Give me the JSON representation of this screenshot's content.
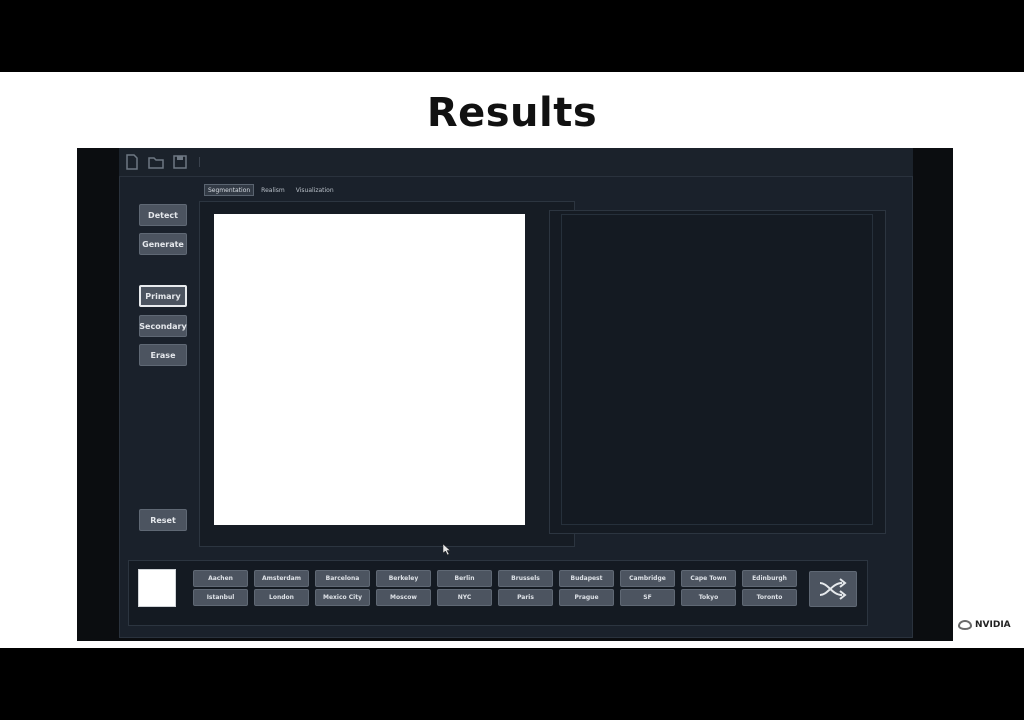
{
  "slide": {
    "title": "Results",
    "logo_text": "NVIDIA"
  },
  "toolbar": {
    "icons": [
      "new-file-icon",
      "open-folder-icon",
      "save-icon"
    ]
  },
  "tabs": [
    "Segmentation",
    "Realism",
    "Visualization"
  ],
  "sidebar": {
    "top_buttons": [
      "Detect",
      "Generate"
    ],
    "brush_buttons": [
      "Primary",
      "Secondary",
      "Erase"
    ],
    "selected": "Primary",
    "reset_label": "Reset"
  },
  "styles": {
    "row1": [
      "Aachen",
      "Amsterdam",
      "Barcelona",
      "Berkeley",
      "Berlin",
      "Brussels",
      "Budapest",
      "Cambridge",
      "Cape Town",
      "Edinburgh"
    ],
    "row2": [
      "Istanbul",
      "London",
      "Mexico City",
      "Moscow",
      "NYC",
      "Paris",
      "Prague",
      "SF",
      "Tokyo",
      "Toronto"
    ]
  },
  "colors": {
    "app_bg": "#1a212b",
    "button_bg": "#4c5460",
    "canvas": "#ffffff"
  }
}
